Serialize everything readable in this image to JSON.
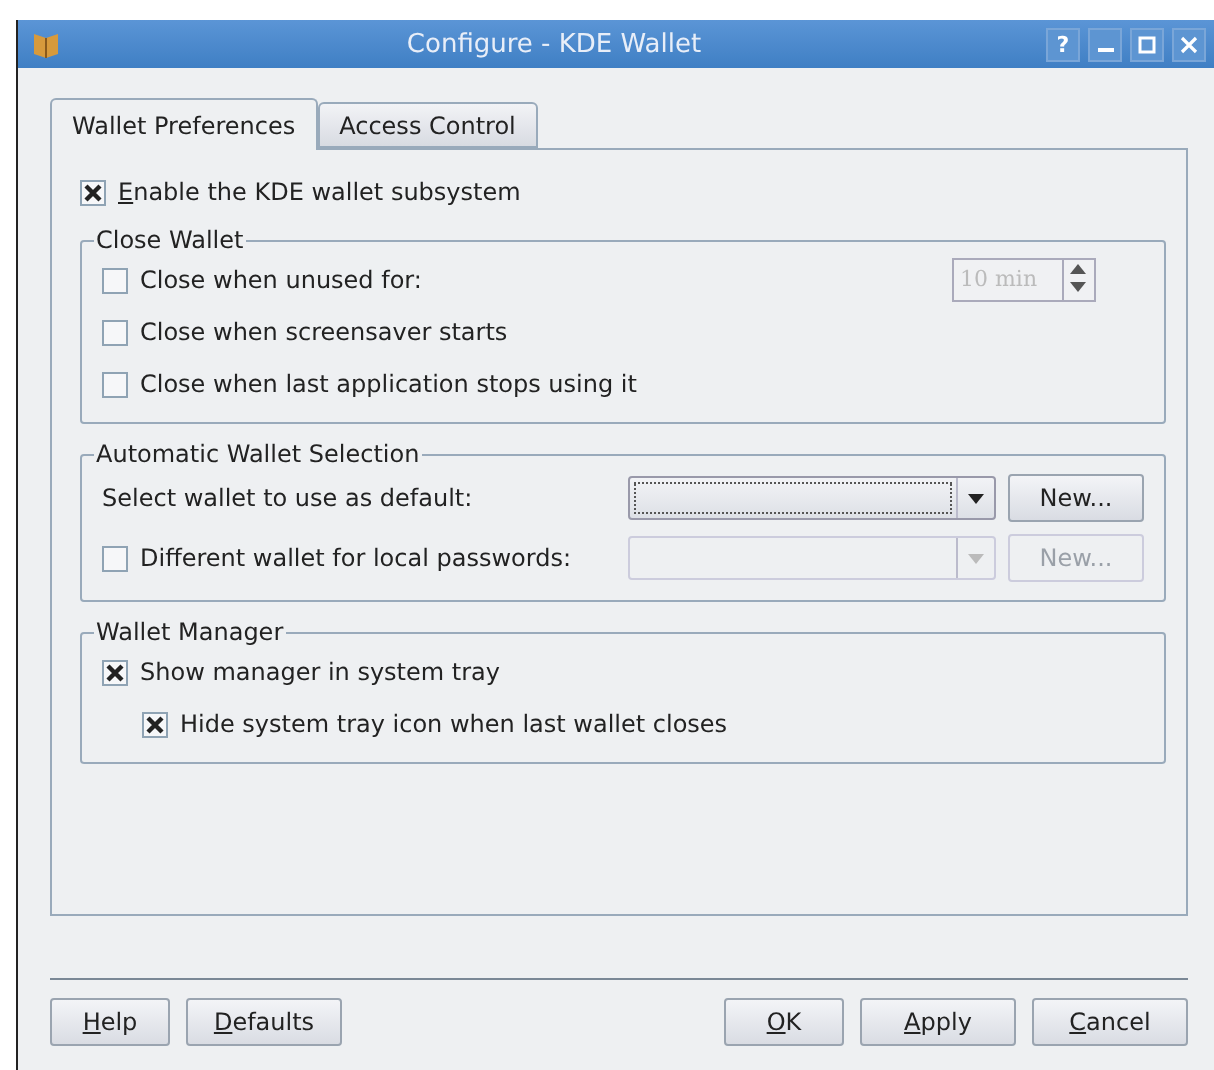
{
  "window": {
    "title": "Configure - KDE Wallet",
    "help_button": "?"
  },
  "tabs": [
    {
      "label": "Wallet Preferences",
      "selected": true
    },
    {
      "label": "Access Control",
      "selected": false
    }
  ],
  "enable": {
    "label": "Enable the KDE wallet subsystem",
    "checked": true
  },
  "close_wallet": {
    "title": "Close Wallet",
    "options": [
      {
        "kind": "spin",
        "label": "Close when unused for:",
        "checked": false,
        "spin_value": "10 min",
        "spin_disabled": true
      },
      {
        "kind": "check",
        "label": "Close when screensaver starts",
        "checked": false
      },
      {
        "kind": "check",
        "label": "Close when last application stops using it",
        "checked": false
      }
    ]
  },
  "wallet_selection": {
    "title": "Automatic Wallet Selection",
    "rows": [
      {
        "kind": "label",
        "label": "Select wallet to use as default:",
        "combo_disabled": false,
        "new_button": "New...",
        "new_disabled": false
      },
      {
        "kind": "check",
        "label": "Different wallet for local passwords:",
        "checked": false,
        "combo_disabled": true,
        "new_button": "New...",
        "new_disabled": true
      }
    ]
  },
  "wallet_manager": {
    "title": "Wallet Manager",
    "options": [
      {
        "label": "Show manager in system tray",
        "checked": true,
        "children": [
          {
            "label": "Hide system tray icon when last wallet closes",
            "checked": true
          }
        ]
      }
    ]
  },
  "buttons_left": [
    "Help",
    "Defaults"
  ],
  "buttons_right": [
    "OK",
    "Apply",
    "Cancel"
  ]
}
